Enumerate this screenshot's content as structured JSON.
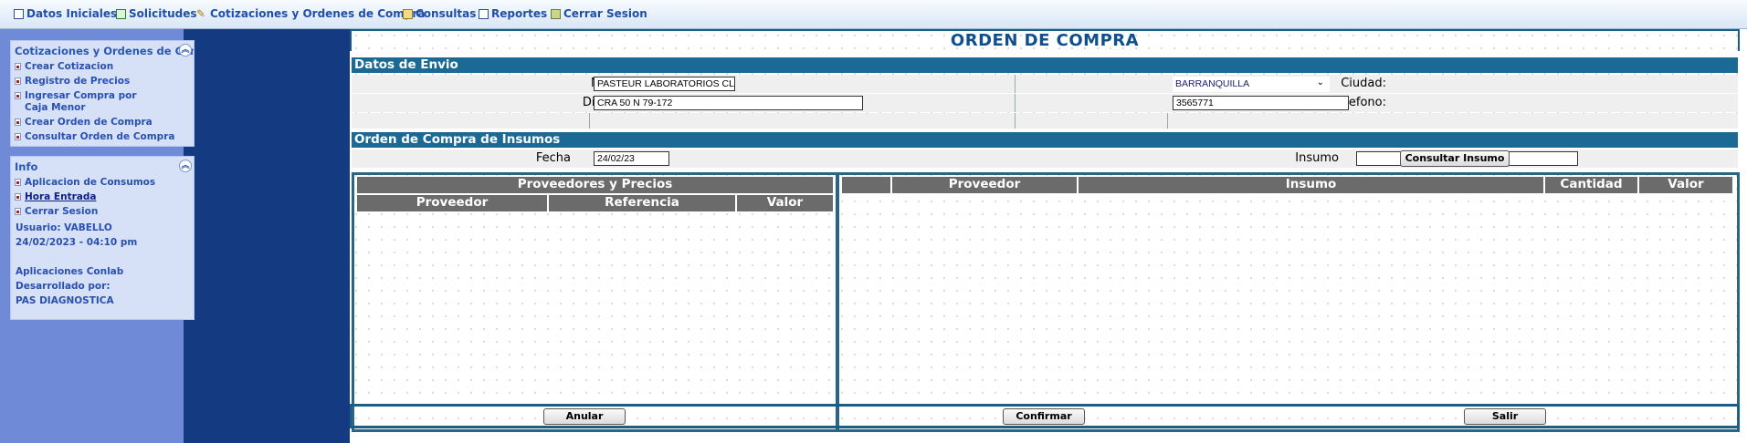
{
  "menu": [
    {
      "label": "Datos Iniciales",
      "icon": "document-icon"
    },
    {
      "label": "Solicitudes",
      "icon": "spreadsheet-icon"
    },
    {
      "label": "Cotizaciones y Ordenes de Compra",
      "icon": "pencil-icon"
    },
    {
      "label": "Consultas",
      "icon": "folder-icon"
    },
    {
      "label": "Reportes",
      "icon": "report-icon"
    },
    {
      "label": "Cerrar Sesion",
      "icon": "exit-icon"
    }
  ],
  "sidebar": {
    "panel1": {
      "title": "Cotizaciones y Ordenes de Compra",
      "items": [
        "Crear Cotizacion",
        "Registro de Precios",
        "Ingresar Compra por Caja Menor",
        "Crear Orden de Compra",
        "Consultar Orden de Compra"
      ]
    },
    "panel2": {
      "title": "Info",
      "items": [
        "Aplicacion de Consumos",
        "Hora Entrada",
        "Cerrar Sesion"
      ],
      "user": "Usuario: VABELLO",
      "datetime": "24/02/2023 - 04:10 pm",
      "app": "Aplicaciones Conlab",
      "dev_label": "Desarrollado por:",
      "dev": "PAS DIAGNOSTICA"
    }
  },
  "main": {
    "title": "ORDEN DE COMPRA",
    "envio": {
      "heading": "Datos de Envio",
      "nombre_label": "Nombre:",
      "nombre_value": "PASTEUR LABORATORIOS CLINICO",
      "ciudad_label": "Ciudad:",
      "ciudad_value": "BARRANQUILLA",
      "direccion_label": "Direccion:",
      "direccion_value": "CRA 50 N 79-172",
      "telefono_label": "Telefono:",
      "telefono_value": "3565771"
    },
    "insumos": {
      "heading": "Orden de Compra de Insumos",
      "fecha_label": "Fecha",
      "fecha_value": "24/02/23",
      "insumo_label": "Insumo",
      "insumo_value": "",
      "consultar_button": "Consultar Insumo"
    },
    "proveedores_table": {
      "title": "Proveedores y Precios",
      "columns": [
        "Proveedor",
        "Referencia",
        "Valor"
      ]
    },
    "orden_table": {
      "columns": [
        "",
        "Proveedor",
        "Insumo",
        "Cantidad",
        "Valor"
      ]
    },
    "buttons": {
      "anular": "Anular",
      "confirmar": "Confirmar",
      "salir": "Salir"
    }
  }
}
